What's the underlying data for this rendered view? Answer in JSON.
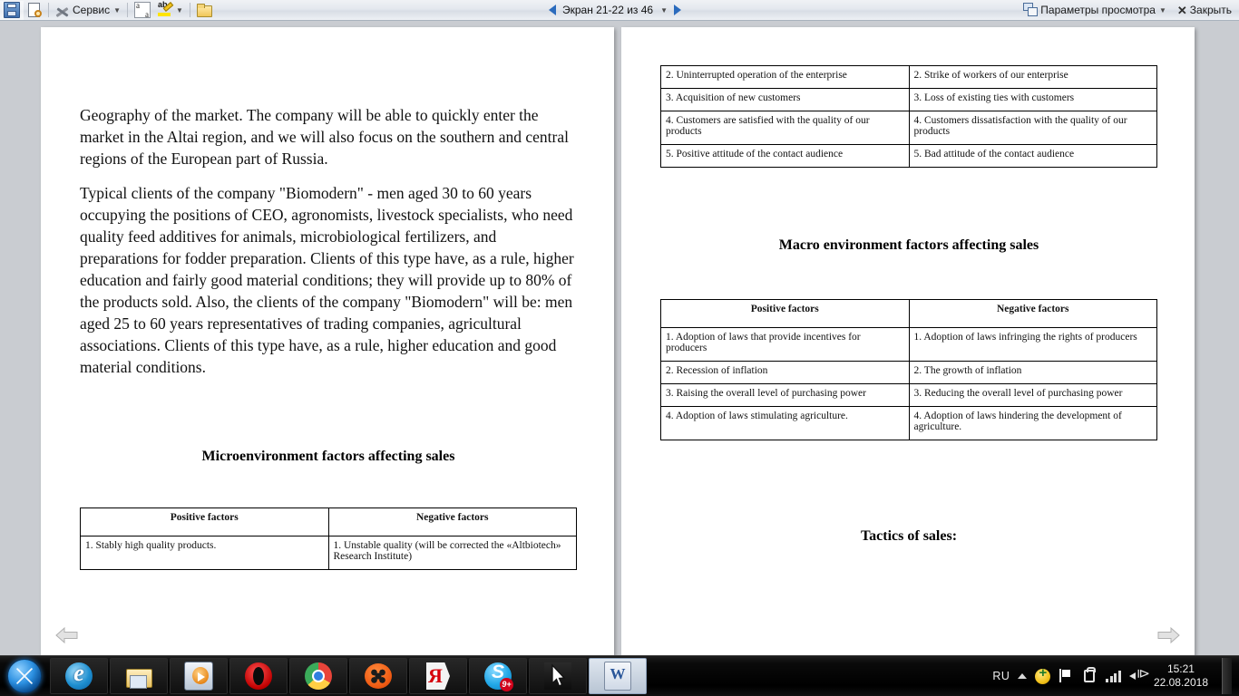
{
  "toolbar": {
    "buttons": [
      {
        "name": "save",
        "icon": "save-icon",
        "label": ""
      },
      {
        "name": "print-preview",
        "icon": "print-preview-icon",
        "label": ""
      },
      {
        "name": "service",
        "icon": "tools-icon",
        "label": "Сервис",
        "caret": true
      },
      {
        "name": "language",
        "icon": "language-icon",
        "label": ""
      },
      {
        "name": "highlight",
        "icon": "highlighter-icon",
        "label": "",
        "caret": true
      },
      {
        "name": "new-folder",
        "icon": "new-folder-icon",
        "label": ""
      }
    ],
    "page_indicator": "Экран 21-22 из 46",
    "view_params_label": "Параметры просмотра",
    "close_label": "Закрыть",
    "close_glyph": "✕"
  },
  "left_page": {
    "paragraphs": [
      "Geography of the market. The company will be able to quickly enter the market in the Altai region, and we will also focus on the southern and central regions of the European part of Russia.",
      "Typical clients of the company \"Biomodern\" - men aged 30 to 60 years occupying the positions of CEO, agronomists, livestock specialists, who need quality feed additives for animals, microbiological fertilizers, and preparations for fodder preparation. Clients of this type have, as a rule, higher education and fairly good material conditions; they will provide up to 80% of the products sold. Also, the clients of the company \"Biomodern\" will be: men aged 25 to 60 years representatives of trading companies, agricultural associations. Clients of this type have, as a rule, higher education and good material conditions."
    ],
    "heading": "Microenvironment factors affecting sales",
    "table": {
      "headers": [
        "Positive factors",
        "Negative factors"
      ],
      "rows": [
        [
          "1. Stably high quality products.",
          "1. Unstable quality (will be corrected the «Altbiotech» Research Institute)"
        ]
      ]
    }
  },
  "right_page": {
    "top_table": {
      "rows": [
        [
          "2. Uninterrupted operation of the enterprise",
          "2. Strike of workers of our enterprise"
        ],
        [
          "3. Acquisition of new customers",
          "3. Loss of existing ties with customers"
        ],
        [
          "4. Customers are satisfied with the quality of our products",
          "4. Customers dissatisfaction with the quality of our products"
        ],
        [
          "5. Positive attitude of the contact audience",
          "5. Bad attitude of the contact audience"
        ]
      ]
    },
    "heading": "Macro environment factors affecting sales",
    "table": {
      "headers": [
        "Positive factors",
        "Negative factors"
      ],
      "rows": [
        [
          "1. Adoption of laws that provide incentives for producers",
          "1. Adoption of laws infringing the rights of producers"
        ],
        [
          "2. Recession of inflation",
          "2. The growth of inflation"
        ],
        [
          "3. Raising the overall level of purchasing power",
          "3. Reducing the overall level of purchasing power"
        ],
        [
          "4. Adoption of laws stimulating agriculture.",
          "4. Adoption of laws hindering the development of agriculture."
        ]
      ]
    },
    "footer_heading": "Tactics of sales:"
  },
  "page_flip": {
    "prev_icon": "arrow-left-icon",
    "next_icon": "arrow-right-icon"
  },
  "taskbar": {
    "start_icon": "windows-start-icon",
    "tasks": [
      {
        "name": "internet-explorer",
        "icon": "internet-explorer-icon"
      },
      {
        "name": "windows-explorer",
        "icon": "folder-icon"
      },
      {
        "name": "windows-media-player",
        "icon": "media-player-icon"
      },
      {
        "name": "opera",
        "icon": "opera-icon"
      },
      {
        "name": "google-chrome",
        "icon": "chrome-icon"
      },
      {
        "name": "km-player",
        "icon": "kmplayer-icon"
      },
      {
        "name": "yandex-browser",
        "icon": "yandex-icon"
      },
      {
        "name": "skype",
        "icon": "skype-icon",
        "badge": "9+"
      },
      {
        "name": "screenshot-tool",
        "icon": "cursor-icon"
      },
      {
        "name": "microsoft-word",
        "icon": "word-icon",
        "active": true
      }
    ],
    "tray": {
      "language": "RU",
      "icons": [
        "show-hidden-icons-icon",
        "antivirus-shield-icon",
        "network-flag-icon",
        "action-center-icon",
        "signal-bars-icon",
        "volume-icon"
      ],
      "time": "15:21",
      "date": "22.08.2018"
    }
  },
  "colors": {
    "desktop": "#c9ccd1",
    "toolbar_accent": "#2b6bbd",
    "page_bg": "#ffffff",
    "taskbar_bg": "#000000"
  }
}
